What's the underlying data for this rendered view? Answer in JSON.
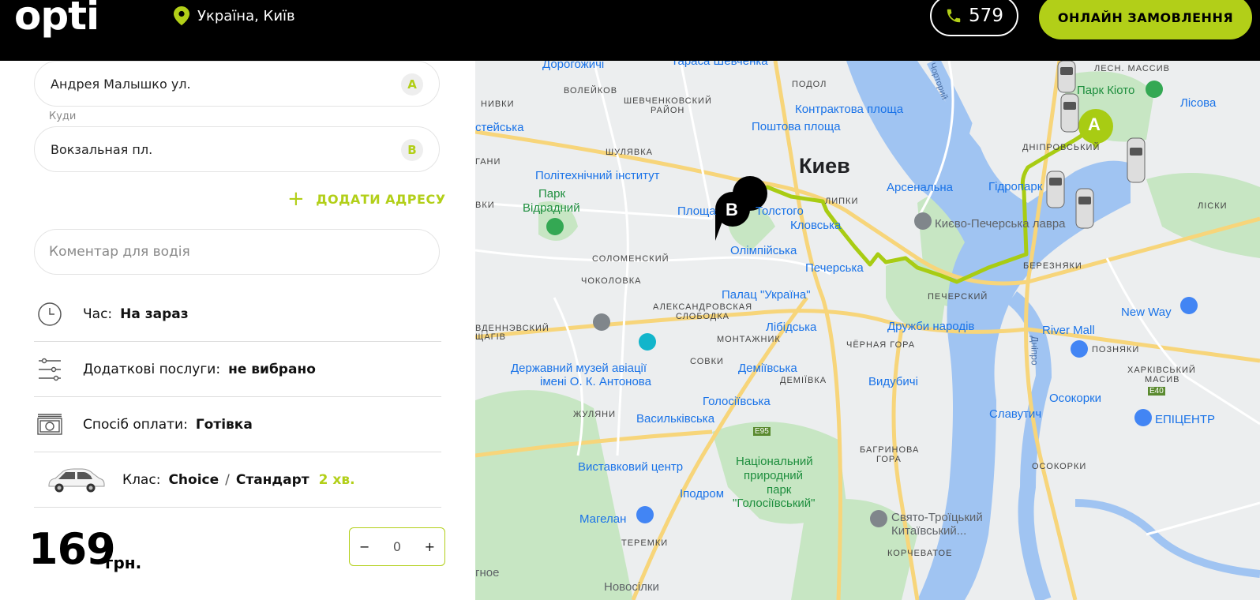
{
  "header": {
    "logo": "opti",
    "location": "Україна, Київ",
    "phone": "579",
    "order_button": "ОНЛАЙН ЗАМОВЛЕННЯ"
  },
  "form": {
    "from_address": "Андрея Малышко ул.",
    "from_badge": "A",
    "to_label": "Куди",
    "to_address": "Вокзальная пл.",
    "to_badge": "B",
    "add_address": "ДОДАТИ АДРЕСУ",
    "comment_placeholder": "Коментар для водія",
    "time_label": "Час:",
    "time_value": "На зараз",
    "extras_label": "Додаткові послуги:",
    "extras_value": "не вибрано",
    "payment_label": "Спосіб оплати:",
    "payment_value": "Готівка",
    "class_label": "Клас:",
    "class_value_1": "Choice",
    "class_sep": "/",
    "class_value_2": "Стандарт",
    "class_eta": "2 хв.",
    "price": "169",
    "currency": "грн.",
    "stepper_minus": "−",
    "stepper_value": "0",
    "stepper_plus": "+"
  },
  "map": {
    "marker_a": "A",
    "marker_b": "B",
    "city": "Киев",
    "labels": [
      "Дорогожичі",
      "Тараса Шевченка",
      "ПОДОЛ",
      "ВОЛЕЙКОВ",
      "ШЕВЧЕНКОВСКИЙ",
      "РАЙОН",
      "НИВКИ",
      "Контрактова площа",
      "Поштова площа",
      "стейська",
      "ШУЛЯВКА",
      "Політехнічний інститут",
      "ДНІПРОВСЬКИЙ",
      "Парк Кіото",
      "Лісова",
      "ЛЕСН. МАССИВ",
      "Парк",
      "Відрадний",
      "Арсенальна",
      "Гідропарк",
      "Кловська",
      "Києво-Печерська лавра",
      "ЛИПКИ",
      "Толстого",
      "Площа",
      "Олімпійська",
      "Печерська",
      "ЛІСКИ",
      "СОЛОМЕНСКИЙ",
      "ЧОКОЛОВКА",
      "АЛЕКСАНДРОВСКАЯ",
      "СЛОБОДКА",
      "Палац \"Україна\"",
      "ПЕЧЕРСКИЙ",
      "Дружби народів",
      "БЕРЕЗНЯКИ",
      "New Way",
      "River Mall",
      "ПОЗНЯКИ",
      "Лібідська",
      "ЧЁРНАЯ ГОРА",
      "МОНТАЖНИК",
      "Державний музей авіації",
      "імені О. К. Антонова",
      "СОВКИ",
      "Деміївська",
      "ДЕМІЇВКА",
      "Видубичі",
      "ХАРКІВСЬКИЙ",
      "МАСИВ",
      "Осокорки",
      "ЖУЛЯНИ",
      "Голосіївська",
      "Васильківська",
      "Славутич",
      "ЕПІЦЕНТР",
      "БАГРИНОВА",
      "ГОРА",
      "ОСОКОРКИ",
      "Виставковий центр",
      "Національний",
      "природний",
      "парк",
      "\"Голосіївський\"",
      "Іподром",
      "Магелан",
      "ТЕРЕМКИ",
      "Свято-Троїцький",
      "Китаївський...",
      "КОРЧЕВАТОЕ",
      "Новосілки",
      "гное",
      "ВДЕННЭВСКИЙ",
      "ЩАГІВ",
      "ВКИ",
      "ГАНИ",
      "E95",
      "E40",
      "Дніпро",
      "Чорторий"
    ],
    "accent_color": "#b2cf18",
    "water_color": "#a0c4f2"
  }
}
